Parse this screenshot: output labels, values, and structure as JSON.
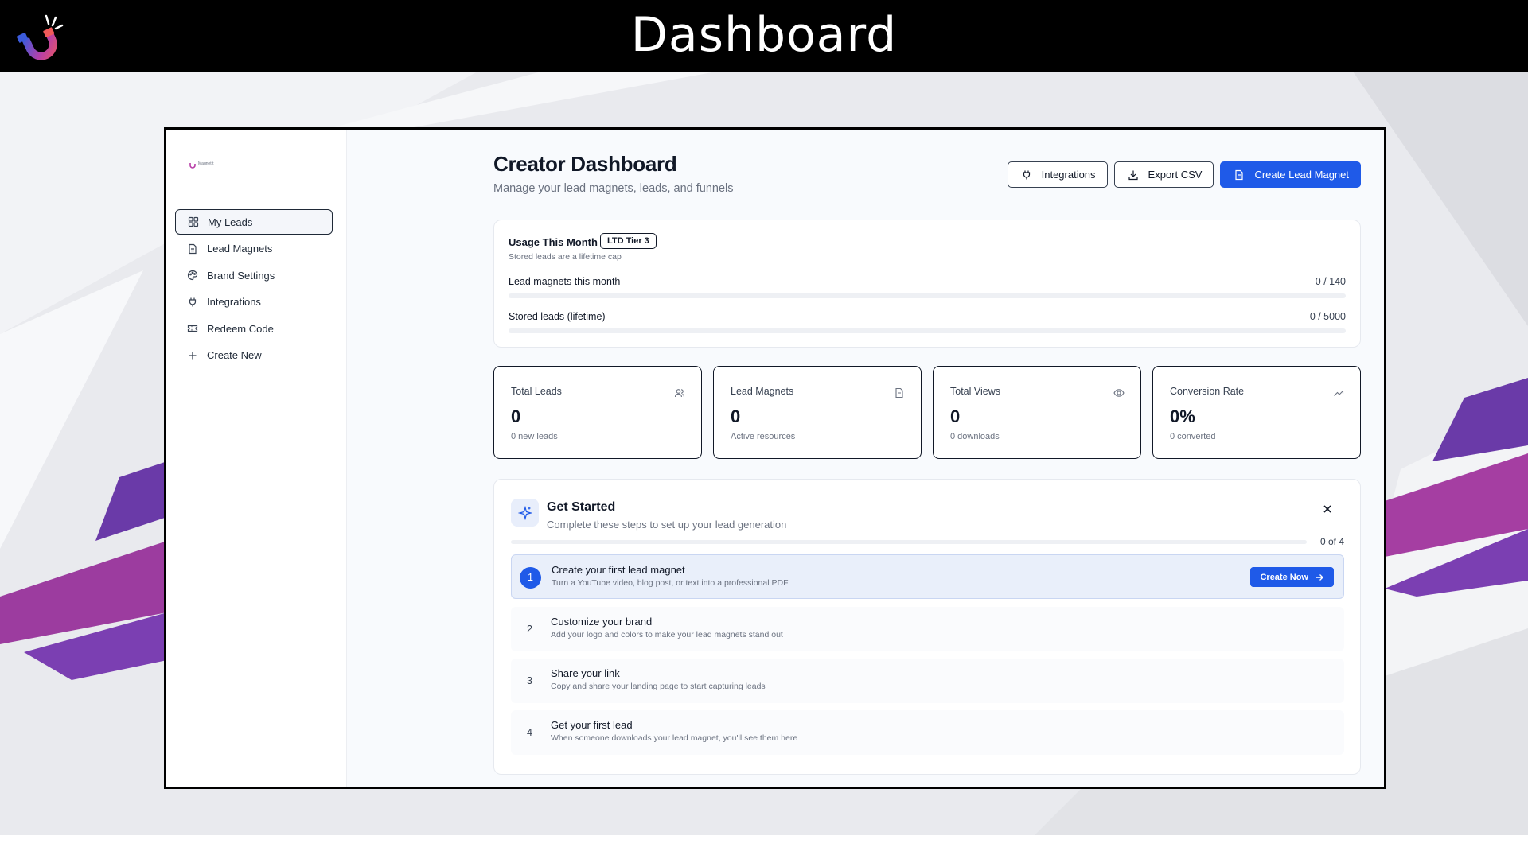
{
  "banner": {
    "title": "Dashboard",
    "logo_icon": "magnet-logo-icon"
  },
  "colors": {
    "accent": "#1f5ae8",
    "banner_bg": "#000000",
    "purple_stripe": "#7a3fb5",
    "magenta_stripe": "#b43ea0"
  },
  "sidebar": {
    "brand": "MagnetIt",
    "items": [
      {
        "label": "My Leads",
        "icon": "grid-icon",
        "active": true
      },
      {
        "label": "Lead Magnets",
        "icon": "document-icon",
        "active": false
      },
      {
        "label": "Brand Settings",
        "icon": "palette-icon",
        "active": false
      },
      {
        "label": "Integrations",
        "icon": "plug-icon",
        "active": false
      },
      {
        "label": "Redeem Code",
        "icon": "ticket-icon",
        "active": false
      },
      {
        "label": "Create New",
        "icon": "plus-icon",
        "active": false
      }
    ]
  },
  "header": {
    "title": "Creator Dashboard",
    "subtitle": "Manage your lead magnets, leads, and funnels",
    "buttons": {
      "integrations": "Integrations",
      "export": "Export CSV",
      "create": "Create Lead Magnet"
    }
  },
  "usage": {
    "title": "Usage This Month",
    "tier": "LTD Tier 3",
    "subtitle": "Stored leads are a lifetime cap",
    "rows": [
      {
        "label": "Lead magnets this month",
        "value": "0 / 140",
        "used": 0,
        "limit": 140
      },
      {
        "label": "Stored leads (lifetime)",
        "value": "0 / 5000",
        "used": 0,
        "limit": 5000
      }
    ]
  },
  "stats": [
    {
      "label": "Total Leads",
      "value": "0",
      "note": "0 new leads",
      "icon": "users-icon"
    },
    {
      "label": "Lead Magnets",
      "value": "0",
      "note": "Active resources",
      "icon": "document-icon"
    },
    {
      "label": "Total Views",
      "value": "0",
      "note": "0 downloads",
      "icon": "eye-icon"
    },
    {
      "label": "Conversion Rate",
      "value": "0%",
      "note": "0 converted",
      "icon": "trending-up-icon"
    }
  ],
  "get_started": {
    "title": "Get Started",
    "subtitle": "Complete these steps to set up your lead generation",
    "progress_text": "0 of 4",
    "completed": 0,
    "total": 4,
    "steps": [
      {
        "number": "1",
        "title": "Create your first lead magnet",
        "description": "Turn a YouTube video, blog post, or text into a professional PDF",
        "button": "Create Now",
        "active": true
      },
      {
        "number": "2",
        "title": "Customize your brand",
        "description": "Add your logo and colors to make your lead magnets stand out",
        "active": false
      },
      {
        "number": "3",
        "title": "Share your link",
        "description": "Copy and share your landing page to start capturing leads",
        "active": false
      },
      {
        "number": "4",
        "title": "Get your first lead",
        "description": "When someone downloads your lead magnet, you'll see them here",
        "active": false
      }
    ]
  }
}
